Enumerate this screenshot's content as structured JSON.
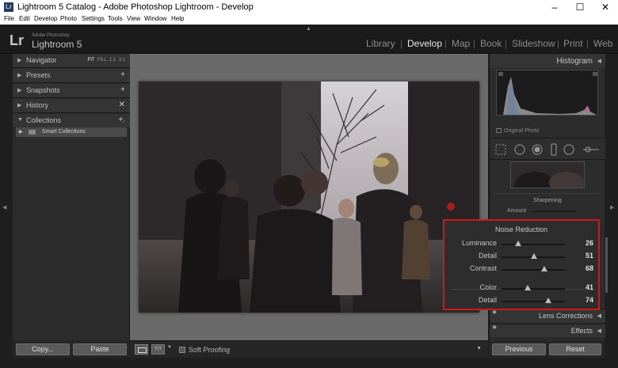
{
  "window": {
    "title": "Lightroom 5 Catalog - Adobe Photoshop Lightroom - Develop",
    "app_icon_text": "Lr",
    "controls": [
      "–",
      "☐",
      "✕"
    ]
  },
  "menu": [
    "File",
    "Edit",
    "Develop",
    "Photo",
    "Settings",
    "Tools",
    "View",
    "Window",
    "Help"
  ],
  "brand": {
    "logo": "Lr",
    "subtitle": "Adobe Photoshop",
    "name": "Lightroom 5"
  },
  "modules": [
    {
      "label": "Library",
      "active": false
    },
    {
      "label": "Develop",
      "active": true
    },
    {
      "label": "Map",
      "active": false
    },
    {
      "label": "Book",
      "active": false
    },
    {
      "label": "Slideshow",
      "active": false
    },
    {
      "label": "Print",
      "active": false
    },
    {
      "label": "Web",
      "active": false
    }
  ],
  "left_panel": {
    "navigator": {
      "label": "Navigator",
      "modes": [
        "FIT",
        "FILL",
        "1:1",
        "3:1"
      ],
      "active_mode": "FIT"
    },
    "sections": [
      {
        "label": "Presets",
        "action": "+"
      },
      {
        "label": "Snapshots",
        "action": "+"
      },
      {
        "label": "History",
        "action": "✕"
      },
      {
        "label": "Collections",
        "action": "+."
      }
    ],
    "smart_collections": "Smart Collections",
    "copy_label": "Copy...",
    "paste_label": "Paste"
  },
  "toolbar": {
    "view_icon": "loupe-view-icon",
    "compare_label": "Y|Y",
    "soft_proofing_label": "Soft Proofing"
  },
  "right_panel": {
    "histogram_label": "Histogram",
    "original_photo_label": "Original Photo",
    "sharpening_label": "Sharpening",
    "amount_label": "Amount",
    "noise_reduction": {
      "title": "Noise Reduction",
      "luminance_sliders": [
        {
          "label": "Luminance",
          "value": "26"
        },
        {
          "label": "Detail",
          "value": "51"
        },
        {
          "label": "Contrast",
          "value": "68"
        }
      ],
      "color_sliders": [
        {
          "label": "Color",
          "value": "41"
        },
        {
          "label": "Detail",
          "value": "74"
        }
      ],
      "highlight_color": "#d01818"
    },
    "lens_corrections_label": "Lens Corrections",
    "effects_label": "Effects",
    "previous_label": "Previous",
    "reset_label": "Reset"
  },
  "colors": {
    "panel": "#2c2c2c",
    "background": "#6a6a6a",
    "active_module": "#e8e8e8",
    "highlight": "#d01818"
  }
}
